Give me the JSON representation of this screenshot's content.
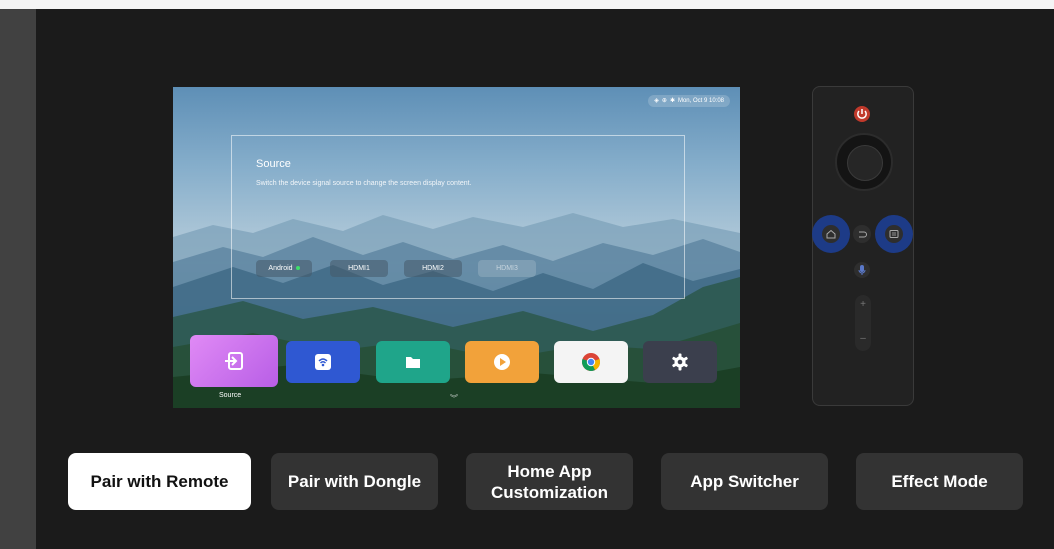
{
  "tv": {
    "status": {
      "icons": [
        "wifi-icon",
        "ethernet-icon",
        "bluetooth-icon"
      ],
      "datetime": "Mon, Oct 9 10:08"
    },
    "source_dialog": {
      "title": "Source",
      "description": "Switch the device signal source to change the screen display content.",
      "sources": [
        {
          "label": "Android",
          "active": true
        },
        {
          "label": "HDMI1",
          "active": false
        },
        {
          "label": "HDMI2",
          "active": false
        },
        {
          "label": "HDMI3",
          "active": false
        }
      ]
    },
    "dock": {
      "items": [
        {
          "name": "source",
          "icon": "source-input-icon",
          "color": "#d16ff0"
        },
        {
          "name": "cast",
          "icon": "cast-icon",
          "color": "#2f58d2"
        },
        {
          "name": "files",
          "icon": "folder-icon",
          "color": "#1fa58a"
        },
        {
          "name": "media-player",
          "icon": "play-icon",
          "color": "#f2a23a"
        },
        {
          "name": "chrome",
          "icon": "chrome-icon",
          "color": "#f4f4f4"
        },
        {
          "name": "settings",
          "icon": "gear-icon",
          "color": "#3b3f4d"
        }
      ],
      "focused_label": "Source"
    }
  },
  "remote": {
    "buttons": [
      "power-icon",
      "dpad",
      "home-icon",
      "back-icon",
      "menu-icon",
      "mic-icon",
      "volume-plus",
      "volume-minus"
    ],
    "volume_plus": "+",
    "volume_minus": "–",
    "highlight_color": "#1d3b87"
  },
  "actions": [
    {
      "label": "Pair with Remote",
      "active": true
    },
    {
      "label": "Pair with Dongle",
      "active": false
    },
    {
      "label": "Home App Customization",
      "active": false
    },
    {
      "label": "App Switcher",
      "active": false
    },
    {
      "label": "Effect Mode",
      "active": false
    }
  ]
}
